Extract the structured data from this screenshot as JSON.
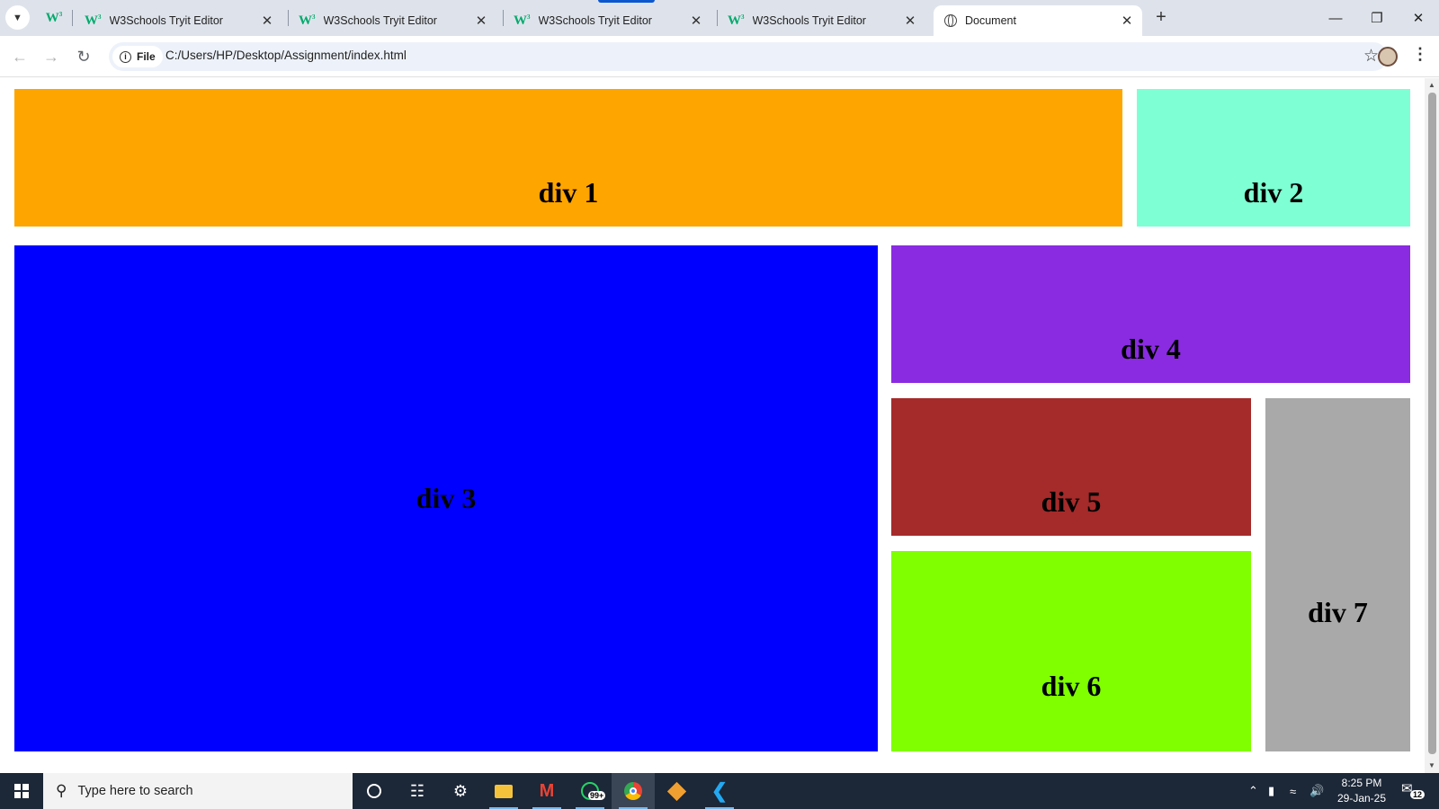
{
  "browser": {
    "tabs": [
      {
        "title": "W3Schools Tryit Editor",
        "active": false
      },
      {
        "title": "W3Schools Tryit Editor",
        "active": false
      },
      {
        "title": "W3Schools Tryit Editor",
        "active": false
      },
      {
        "title": "W3Schools Tryit Editor",
        "active": false
      },
      {
        "title": "Document",
        "active": true
      }
    ],
    "pinned_icon": "w3schools-icon",
    "new_tab_label": "+",
    "close_label": "✕",
    "address": {
      "chip_label": "File",
      "url": "C:/Users/HP/Desktop/Assignment/index.html"
    }
  },
  "page": {
    "boxes": [
      {
        "label": "div 1",
        "color": "#ffa500"
      },
      {
        "label": "div 2",
        "color": "#7fffd4"
      },
      {
        "label": "div 3",
        "color": "#0000ff"
      },
      {
        "label": "div 4",
        "color": "#8a2be2"
      },
      {
        "label": "div 5",
        "color": "#a52a2a"
      },
      {
        "label": "div 6",
        "color": "#7fff00"
      },
      {
        "label": "div 7",
        "color": "#a9a9a9"
      }
    ]
  },
  "taskbar": {
    "search_placeholder": "Type here to search",
    "whatsapp_badge": "99+",
    "time": "8:25 PM",
    "date": "29-Jan-25",
    "notification_count": "12"
  }
}
